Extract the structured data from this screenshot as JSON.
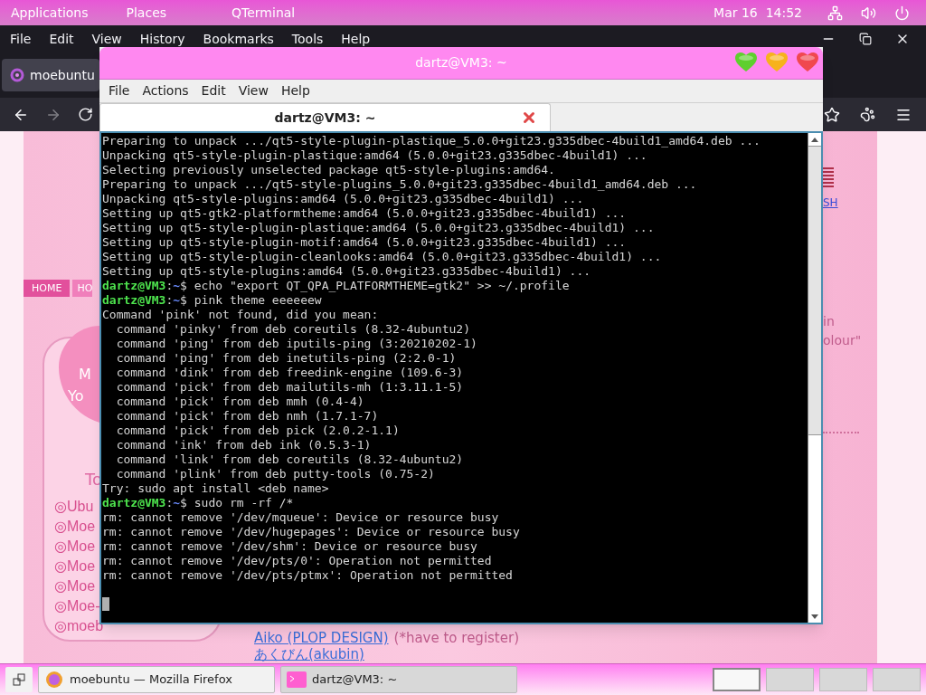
{
  "top_panel": {
    "menus": [
      "Applications",
      "Places",
      "QTerminal"
    ],
    "clock": "Mar 16  14:52"
  },
  "browser": {
    "menu": [
      "File",
      "Edit",
      "View",
      "History",
      "Bookmarks",
      "Tools",
      "Help"
    ],
    "tab": {
      "title": "moebuntu"
    },
    "page": {
      "nav_tabs": [
        {
          "label": "HOME",
          "selected": true
        },
        {
          "label": "HO",
          "selected": false
        }
      ],
      "card": {
        "heart_lines": [
          "M",
          "Yo"
        ],
        "heading": "To",
        "links": [
          "◎Ubu",
          "◎Moe",
          "◎Moe",
          "◎Moe",
          "◎Moe",
          "◎Moe-",
          "◎moeb"
        ]
      },
      "side_link": "SH",
      "side_text": [
        "in",
        "olour\""
      ],
      "bottom_links": [
        {
          "text": "Aiko (PLOP DESIGN)",
          "note": "(*have to register)"
        },
        {
          "text": "あくびん(akubin)"
        }
      ]
    }
  },
  "terminal": {
    "title": "dartz@VM3: ~",
    "menu": [
      "File",
      "Actions",
      "Edit",
      "View",
      "Help"
    ],
    "tabs": [
      {
        "label": "dartz@VM3: ~",
        "selected": true
      }
    ],
    "lines": [
      {
        "kind": "output",
        "text": "Preparing to unpack .../qt5-style-plugin-plastique_5.0.0+git23.g335dbec-4build1_amd64.deb ..."
      },
      {
        "kind": "output",
        "text": "Unpacking qt5-style-plugin-plastique:amd64 (5.0.0+git23.g335dbec-4build1) ..."
      },
      {
        "kind": "output",
        "text": "Selecting previously unselected package qt5-style-plugins:amd64."
      },
      {
        "kind": "output",
        "text": "Preparing to unpack .../qt5-style-plugins_5.0.0+git23.g335dbec-4build1_amd64.deb ..."
      },
      {
        "kind": "output",
        "text": "Unpacking qt5-style-plugins:amd64 (5.0.0+git23.g335dbec-4build1) ..."
      },
      {
        "kind": "output",
        "text": "Setting up qt5-gtk2-platformtheme:amd64 (5.0.0+git23.g335dbec-4build1) ..."
      },
      {
        "kind": "output",
        "text": "Setting up qt5-style-plugin-plastique:amd64 (5.0.0+git23.g335dbec-4build1) ..."
      },
      {
        "kind": "output",
        "text": "Setting up qt5-style-plugin-motif:amd64 (5.0.0+git23.g335dbec-4build1) ..."
      },
      {
        "kind": "output",
        "text": "Setting up qt5-style-plugin-cleanlooks:amd64 (5.0.0+git23.g335dbec-4build1) ..."
      },
      {
        "kind": "output",
        "text": "Setting up qt5-style-plugins:amd64 (5.0.0+git23.g335dbec-4build1) ..."
      },
      {
        "kind": "prompt",
        "user": "dartz@VM3",
        "sep": ":",
        "path": "~",
        "command": "$ echo \"export QT_QPA_PLATFORMTHEME=gtk2\" >> ~/.profile"
      },
      {
        "kind": "prompt",
        "user": "dartz@VM3",
        "sep": ":",
        "path": "~",
        "command": "$ pink theme eeeeeew"
      },
      {
        "kind": "output",
        "text": "Command 'pink' not found, did you mean:"
      },
      {
        "kind": "output",
        "text": "  command 'pinky' from deb coreutils (8.32-4ubuntu2)"
      },
      {
        "kind": "output",
        "text": "  command 'ping' from deb iputils-ping (3:20210202-1)"
      },
      {
        "kind": "output",
        "text": "  command 'ping' from deb inetutils-ping (2:2.0-1)"
      },
      {
        "kind": "output",
        "text": "  command 'dink' from deb freedink-engine (109.6-3)"
      },
      {
        "kind": "output",
        "text": "  command 'pick' from deb mailutils-mh (1:3.11.1-5)"
      },
      {
        "kind": "output",
        "text": "  command 'pick' from deb mmh (0.4-4)"
      },
      {
        "kind": "output",
        "text": "  command 'pick' from deb nmh (1.7.1-7)"
      },
      {
        "kind": "output",
        "text": "  command 'pick' from deb pick (2.0.2-1.1)"
      },
      {
        "kind": "output",
        "text": "  command 'ink' from deb ink (0.5.3-1)"
      },
      {
        "kind": "output",
        "text": "  command 'link' from deb coreutils (8.32-4ubuntu2)"
      },
      {
        "kind": "output",
        "text": "  command 'plink' from deb putty-tools (0.75-2)"
      },
      {
        "kind": "output",
        "text": "Try: sudo apt install <deb name>"
      },
      {
        "kind": "prompt",
        "user": "dartz@VM3",
        "sep": ":",
        "path": "~",
        "command": "$ sudo rm -rf /*"
      },
      {
        "kind": "output",
        "text": "rm: cannot remove '/dev/mqueue': Device or resource busy"
      },
      {
        "kind": "output",
        "text": "rm: cannot remove '/dev/hugepages': Device or resource busy"
      },
      {
        "kind": "output",
        "text": "rm: cannot remove '/dev/shm': Device or resource busy"
      },
      {
        "kind": "output",
        "text": "rm: cannot remove '/dev/pts/0': Operation not permitted"
      },
      {
        "kind": "output",
        "text": "rm: cannot remove '/dev/pts/ptmx': Operation not permitted"
      },
      {
        "kind": "cursor"
      }
    ]
  },
  "taskbar": {
    "tasks": [
      {
        "kind": "browser",
        "label": "moebuntu — Mozilla Firefox",
        "selected": false
      },
      {
        "kind": "terminal",
        "label": "dartz@VM3: ~",
        "selected": true
      }
    ],
    "workspaces": [
      {
        "selected": true
      },
      {
        "selected": false
      },
      {
        "selected": false
      },
      {
        "selected": false
      }
    ]
  }
}
